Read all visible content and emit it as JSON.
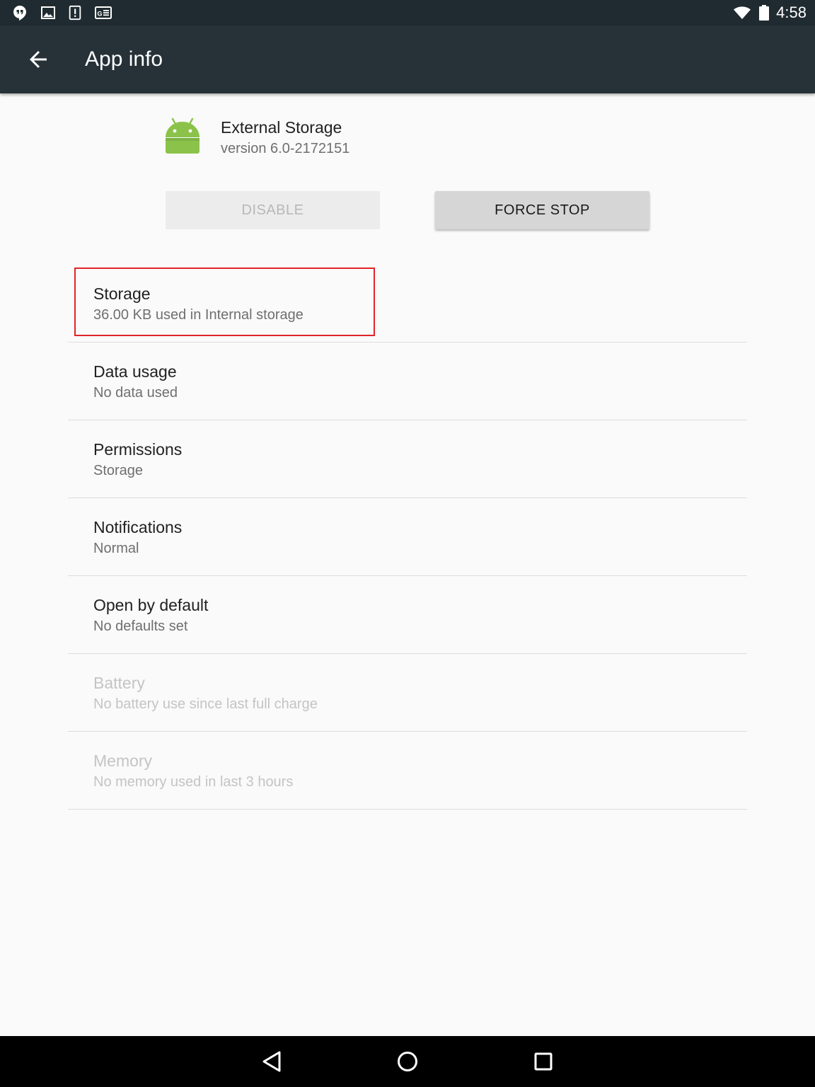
{
  "status_bar": {
    "time": "4:58",
    "left_icons": [
      "hangouts-icon",
      "image-icon",
      "alert-icon",
      "news-icon"
    ],
    "right_icons": [
      "wifi-icon",
      "battery-icon"
    ]
  },
  "app_bar": {
    "title": "App info",
    "back_icon": "arrow-back-icon"
  },
  "app_header": {
    "name": "External Storage",
    "version": "version 6.0-2172151",
    "icon": "android-icon",
    "icon_color": "#8bc34a"
  },
  "buttons": {
    "disable": "DISABLE",
    "force_stop": "FORCE STOP"
  },
  "settings": [
    {
      "title": "Storage",
      "subtitle": "36.00 KB used in Internal storage",
      "enabled": true,
      "highlighted": true
    },
    {
      "title": "Data usage",
      "subtitle": "No data used",
      "enabled": true
    },
    {
      "title": "Permissions",
      "subtitle": "Storage",
      "enabled": true
    },
    {
      "title": "Notifications",
      "subtitle": "Normal",
      "enabled": true
    },
    {
      "title": "Open by default",
      "subtitle": "No defaults set",
      "enabled": true
    },
    {
      "title": "Battery",
      "subtitle": "No battery use since last full charge",
      "enabled": false
    },
    {
      "title": "Memory",
      "subtitle": "No memory used in last 3 hours",
      "enabled": false
    }
  ],
  "nav_bar": {
    "icons": [
      "back-triangle-icon",
      "home-circle-icon",
      "recents-square-icon"
    ]
  },
  "colors": {
    "status_bar": "#202b31",
    "app_bar": "#263238",
    "background": "#fafafa",
    "highlight_border": "#e0242b"
  }
}
